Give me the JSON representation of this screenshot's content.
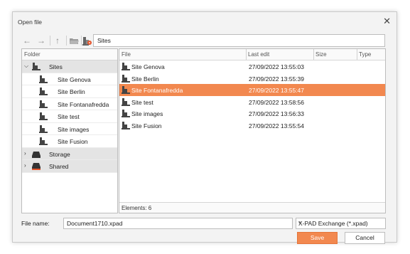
{
  "window": {
    "title": "Open file",
    "close_glyph": "✕"
  },
  "toolbar": {
    "icons": [
      "back-arrow-icon",
      "forward-arrow-icon",
      "up-arrow-icon",
      "folder-open-icon",
      "new-site-icon"
    ],
    "address": "Sites"
  },
  "folder_panel": {
    "header": "Folder",
    "items": [
      {
        "label": "Sites",
        "expanded": true,
        "icon": "site-icon"
      },
      {
        "label": "Site Genova",
        "icon": "site-icon"
      },
      {
        "label": "Site Berlin",
        "icon": "site-icon"
      },
      {
        "label": "Site Fontanafredda",
        "icon": "site-icon"
      },
      {
        "label": "Site test",
        "icon": "site-icon"
      },
      {
        "label": "Site images",
        "icon": "site-icon"
      },
      {
        "label": "Site Fusion",
        "icon": "site-icon"
      },
      {
        "label": "Storage",
        "expanded": false,
        "icon": "storage-icon"
      },
      {
        "label": "Shared",
        "expanded": false,
        "icon": "shared-storage-icon"
      }
    ]
  },
  "file_panel": {
    "columns": [
      "File",
      "Last edit",
      "Size",
      "Type"
    ],
    "rows": [
      {
        "name": "Site Genova",
        "last_edit": "27/09/2022 13:55:03",
        "size": "",
        "type": ""
      },
      {
        "name": "Site Berlin",
        "last_edit": "27/09/2022 13:55:39",
        "size": "",
        "type": ""
      },
      {
        "name": "Site Fontanafredda",
        "last_edit": "27/09/2022 13:55:47",
        "size": "",
        "type": "",
        "selected": true
      },
      {
        "name": "Site test",
        "last_edit": "27/09/2022 13:58:56",
        "size": "",
        "type": ""
      },
      {
        "name": "Site images",
        "last_edit": "27/09/2022 13:56:33",
        "size": "",
        "type": ""
      },
      {
        "name": "Site Fusion",
        "last_edit": "27/09/2022 13:55:54",
        "size": "",
        "type": ""
      }
    ],
    "status": "Elements: 6"
  },
  "footer": {
    "file_name_label": "File name:",
    "file_name_value": "Document1710.xpad",
    "file_type": "X-PAD Exchange (*.xpad)",
    "save_label": "Save",
    "cancel_label": "Cancel"
  },
  "colors": {
    "accent": "#f2884f",
    "panel_bg": "#ffffff",
    "dialog_bg": "#f3f3f3"
  }
}
